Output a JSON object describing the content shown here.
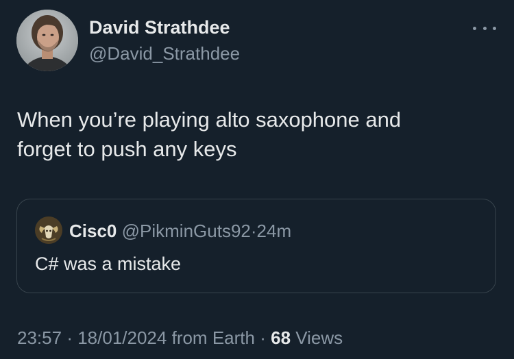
{
  "author": {
    "name": "David Strathdee",
    "handle": "@David_Strathdee"
  },
  "tweet": {
    "text_line1": "When you’re playing alto saxophone and",
    "text_line2": "forget to push any keys"
  },
  "quote": {
    "name": "Cisc0",
    "handle": "@PikminGuts92",
    "separator": "·",
    "time": "24m",
    "text": "C# was a mistake"
  },
  "meta": {
    "time": "23:57",
    "sep1": "·",
    "date": "18/01/2024",
    "source": "from Earth",
    "sep2": "·",
    "views_count": "68",
    "views_label": "Views"
  },
  "icons": {
    "more": "more-horizontal-icon"
  },
  "colors": {
    "background": "#15202b",
    "primary_text": "#e7e9ea",
    "secondary_text": "#8b98a5",
    "border": "#38444d"
  }
}
